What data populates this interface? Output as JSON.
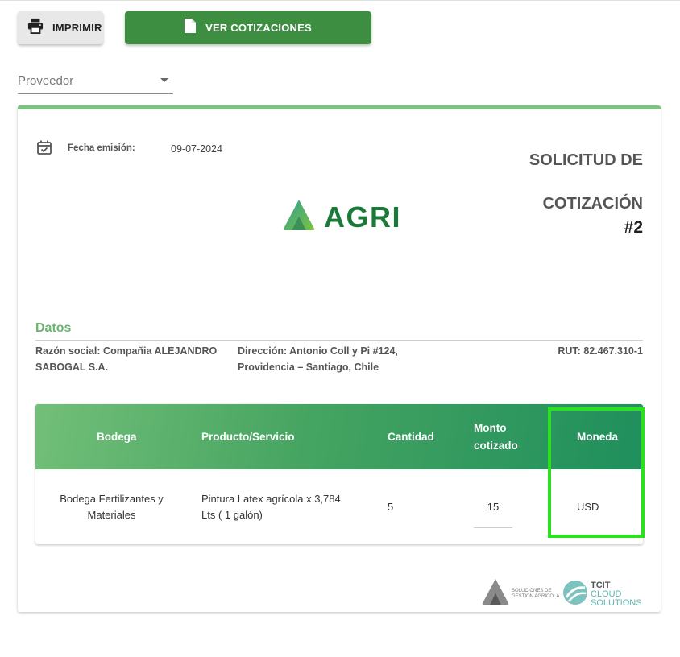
{
  "toolbar": {
    "print_label": "IMPRIMIR",
    "quotes_label": "VER COTIZACIONES"
  },
  "filters": {
    "provider_placeholder": "Proveedor"
  },
  "document": {
    "date_label": "Fecha emisión:",
    "date_value": "09-07-2024",
    "title_line1": "SOLICITUD DE",
    "title_line2": "COTIZACIÓN",
    "number": "#2",
    "logo_text": "AGRI"
  },
  "datos": {
    "heading": "Datos",
    "razon_social": "Razón social: Compañia ALEJANDRO SABOGAL S.A.",
    "direccion": "Dirección: Antonio Coll y Pi #124, Providencia – Santiago, Chile",
    "rut": "RUT: 82.467.310-1"
  },
  "table": {
    "headers": {
      "bodega": "Bodega",
      "producto": "Producto/Servicio",
      "cantidad": "Cantidad",
      "monto": "Monto cotizado",
      "moneda": "Moneda"
    },
    "rows": [
      {
        "bodega": "Bodega Fertilizantes y Materiales",
        "producto": "Pintura Latex agrícola x 3,784 Lts ( 1 galón)",
        "cantidad": "5",
        "monto": "15",
        "moneda": "USD"
      }
    ]
  },
  "footer": {
    "agri_tagline": "SOLUCIONES DE GESTIÓN AGRÍCOLA",
    "tcit_line1": "TCIT",
    "tcit_line2": "CLOUD",
    "tcit_line3": "SOLUTIONS"
  },
  "colors": {
    "primary_green": "#3e8e41",
    "accent_green": "#7bc47f",
    "highlight": "#2be01c"
  }
}
